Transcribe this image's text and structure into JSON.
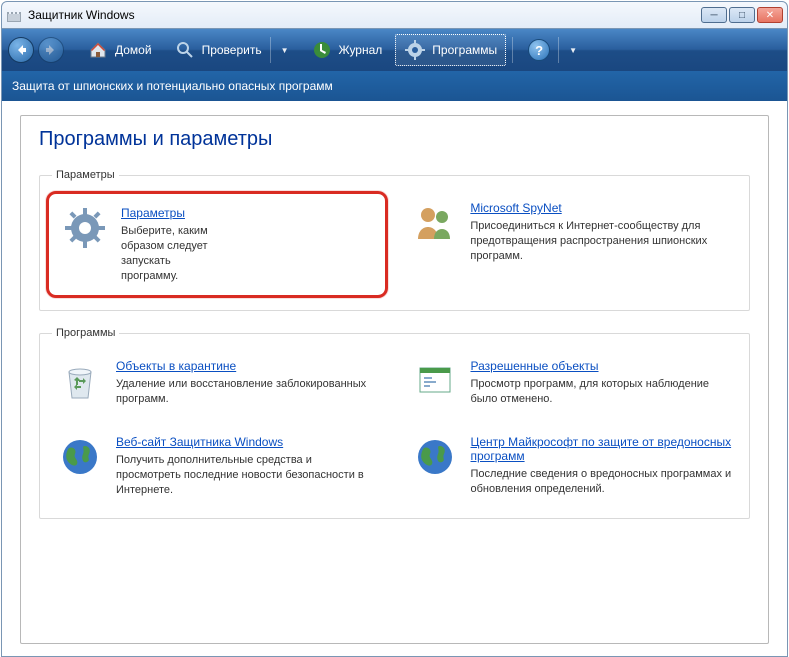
{
  "titlebar": {
    "title": "Защитник Windows"
  },
  "toolbar": {
    "home": "Домой",
    "check": "Проверить",
    "journal": "Журнал",
    "programs": "Программы"
  },
  "subheader": "Защита от шпионских  и потенциально опасных программ",
  "page": {
    "heading": "Программы и параметры",
    "groups": {
      "parameters": {
        "legend": "Параметры",
        "items": {
          "settings": {
            "title": "Параметры",
            "desc": "Выберите, каким образом следует запускать программу."
          },
          "spynet": {
            "title": "Microsoft SpyNet",
            "desc": "Присоединиться к Интернет-сообществу для предотвращения распространения шпионских программ."
          }
        }
      },
      "programs": {
        "legend": "Программы",
        "items": {
          "quarantine": {
            "title": "Объекты в карантине",
            "desc": "Удаление или восстановление заблокированных программ."
          },
          "allowed": {
            "title": "Разрешенные объекты",
            "desc": "Просмотр программ, для которых наблюдение было отменено."
          },
          "website": {
            "title": "Веб-сайт Защитника Windows",
            "desc": "Получить дополнительные средства и просмотреть последние новости безопасности в Интернете."
          },
          "protection": {
            "title": "Центр Майкрософт по защите от вредоносных программ",
            "desc": "Последние сведения о вредоносных программах и обновления определений."
          }
        }
      }
    }
  }
}
